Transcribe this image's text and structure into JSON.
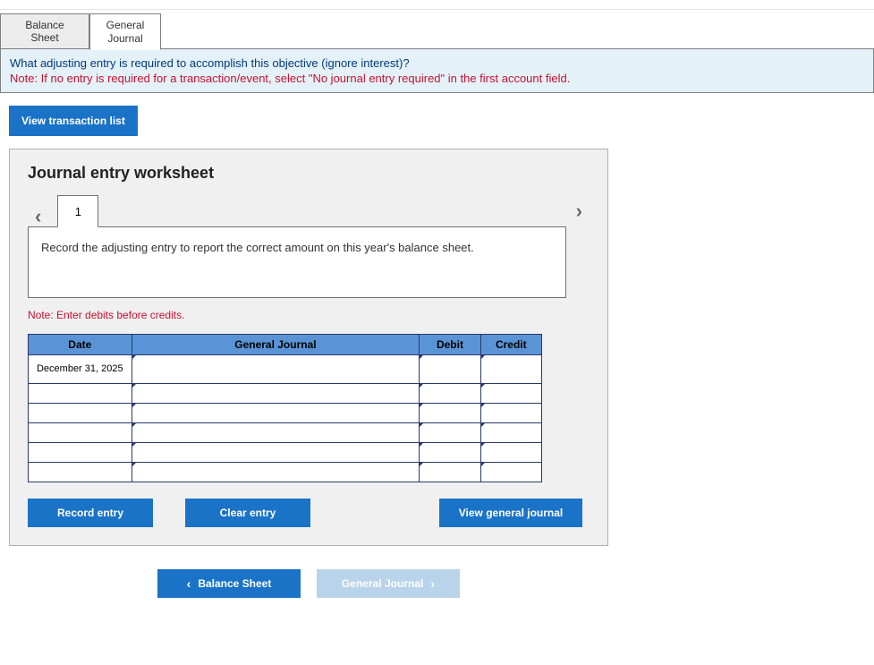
{
  "top_tabs": {
    "balance_sheet": "Balance Sheet",
    "general_journal": "General\nJournal"
  },
  "info": {
    "question": "What adjusting entry is required to accomplish this objective (ignore interest)?",
    "note": "Note: If no entry is required for a transaction/event, select \"No journal entry required\" in the first account field."
  },
  "buttons": {
    "view_transaction_list": "View transaction list",
    "record_entry": "Record entry",
    "clear_entry": "Clear entry",
    "view_general_journal": "View general journal"
  },
  "worksheet": {
    "title": "Journal entry worksheet",
    "page": "1",
    "instruction": "Record the adjusting entry to report the correct amount on this year's balance sheet.",
    "note": "Note: Enter debits before credits."
  },
  "table": {
    "headers": {
      "date": "Date",
      "gj": "General Journal",
      "debit": "Debit",
      "credit": "Credit"
    },
    "rows": [
      {
        "date": "December 31, 2025",
        "gj": "",
        "debit": "",
        "credit": ""
      },
      {
        "date": "",
        "gj": "",
        "debit": "",
        "credit": ""
      },
      {
        "date": "",
        "gj": "",
        "debit": "",
        "credit": ""
      },
      {
        "date": "",
        "gj": "",
        "debit": "",
        "credit": ""
      },
      {
        "date": "",
        "gj": "",
        "debit": "",
        "credit": ""
      },
      {
        "date": "",
        "gj": "",
        "debit": "",
        "credit": ""
      }
    ]
  },
  "nav": {
    "prev": "Balance Sheet",
    "next": "General Journal"
  }
}
